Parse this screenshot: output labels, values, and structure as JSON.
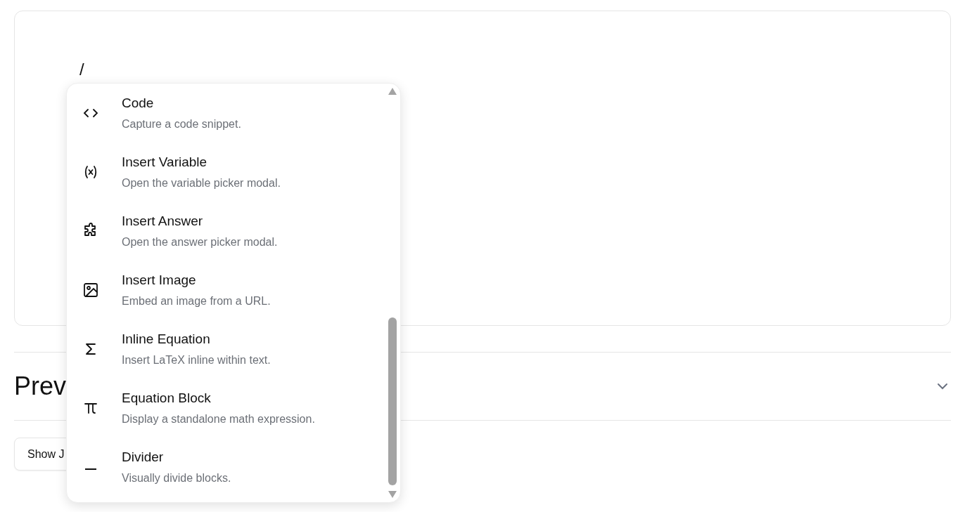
{
  "editor": {
    "text": "/"
  },
  "preview": {
    "heading": "Prev"
  },
  "show_button": {
    "label": "Show J"
  },
  "slash_menu": {
    "items": [
      {
        "kind": "code",
        "title": "Code",
        "description": "Capture a code snippet."
      },
      {
        "kind": "variable",
        "title": "Insert Variable",
        "description": "Open the variable picker modal."
      },
      {
        "kind": "answer",
        "title": "Insert Answer",
        "description": "Open the answer picker modal."
      },
      {
        "kind": "image",
        "title": "Insert Image",
        "description": "Embed an image from a URL."
      },
      {
        "kind": "inline-equation",
        "title": "Inline Equation",
        "description": "Insert LaTeX inline within text."
      },
      {
        "kind": "equation-block",
        "title": "Equation Block",
        "description": "Display a standalone math expression."
      },
      {
        "kind": "divider",
        "title": "Divider",
        "description": "Visually divide blocks."
      }
    ]
  }
}
